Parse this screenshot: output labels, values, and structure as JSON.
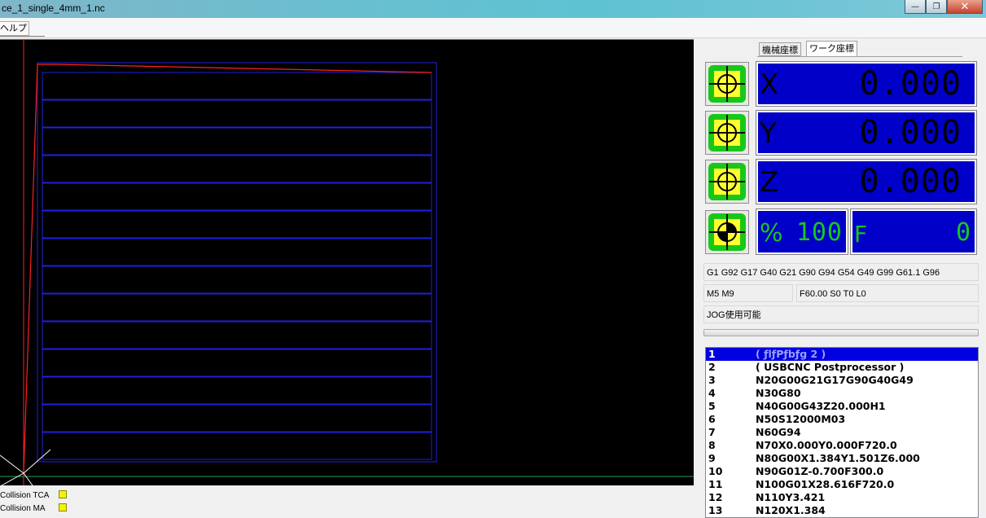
{
  "window": {
    "title": "ce_1_single_4mm_1.nc",
    "minimize_glyph": "—",
    "maximize_glyph": "❐",
    "close_glyph": "✕"
  },
  "menu": {
    "help_label": "ヘルプ"
  },
  "status": {
    "collision_tca_label": "Collision TCA",
    "collision_ma_label": "Collision MA",
    "indicator_color": "#f3f300"
  },
  "tabs": [
    {
      "label": "機械座標",
      "active": false
    },
    {
      "label": "ワーク座標",
      "active": true
    }
  ],
  "dro": {
    "x": {
      "letter": "X",
      "value": "0.000"
    },
    "y": {
      "letter": "Y",
      "value": "0.000"
    },
    "z": {
      "letter": "Z",
      "value": "0.000"
    },
    "override": {
      "symbol": "%",
      "value": "100"
    },
    "feed": {
      "letter": "F",
      "value": "0"
    },
    "field_color": "#0000c8",
    "button_icon": "crosshair-target-icon",
    "home_icon": "home-target-icon"
  },
  "info": {
    "modal_codes": "G1 G92 G17 G40 G21 G90 G94 G54 G49 G99 G61.1 G96",
    "spindle_coolant": "M5 M9",
    "feed_spindle_tool": "F60.00 S0 T0 L0",
    "jog_status": "JOG使用可能"
  },
  "gcode": {
    "lines": [
      {
        "num": "1",
        "code": "( ƒlƒPƒbƒg 2 )",
        "selected": true
      },
      {
        "num": "2",
        "code": "( USBCNC Postprocessor )"
      },
      {
        "num": "3",
        "code": "N20G00G21G17G90G40G49"
      },
      {
        "num": "4",
        "code": "N30G80"
      },
      {
        "num": "5",
        "code": "N40G00G43Z20.000H1"
      },
      {
        "num": "6",
        "code": "N50S12000M03"
      },
      {
        "num": "7",
        "code": "N60G94"
      },
      {
        "num": "8",
        "code": "N70X0.000Y0.000F720.0"
      },
      {
        "num": "9",
        "code": "N80G00X1.384Y1.501Z6.000"
      },
      {
        "num": "10",
        "code": "N90G01Z-0.700F300.0"
      },
      {
        "num": "11",
        "code": "N100G01X28.616F720.0"
      },
      {
        "num": "12",
        "code": "N110Y3.421"
      },
      {
        "num": "13",
        "code": "N120X1.384"
      }
    ]
  },
  "toolpath": {
    "colors": {
      "rapid": "#ff2020",
      "feed": "#2020e0",
      "axis_x": "#20a060",
      "origin": "#ffffff"
    }
  }
}
